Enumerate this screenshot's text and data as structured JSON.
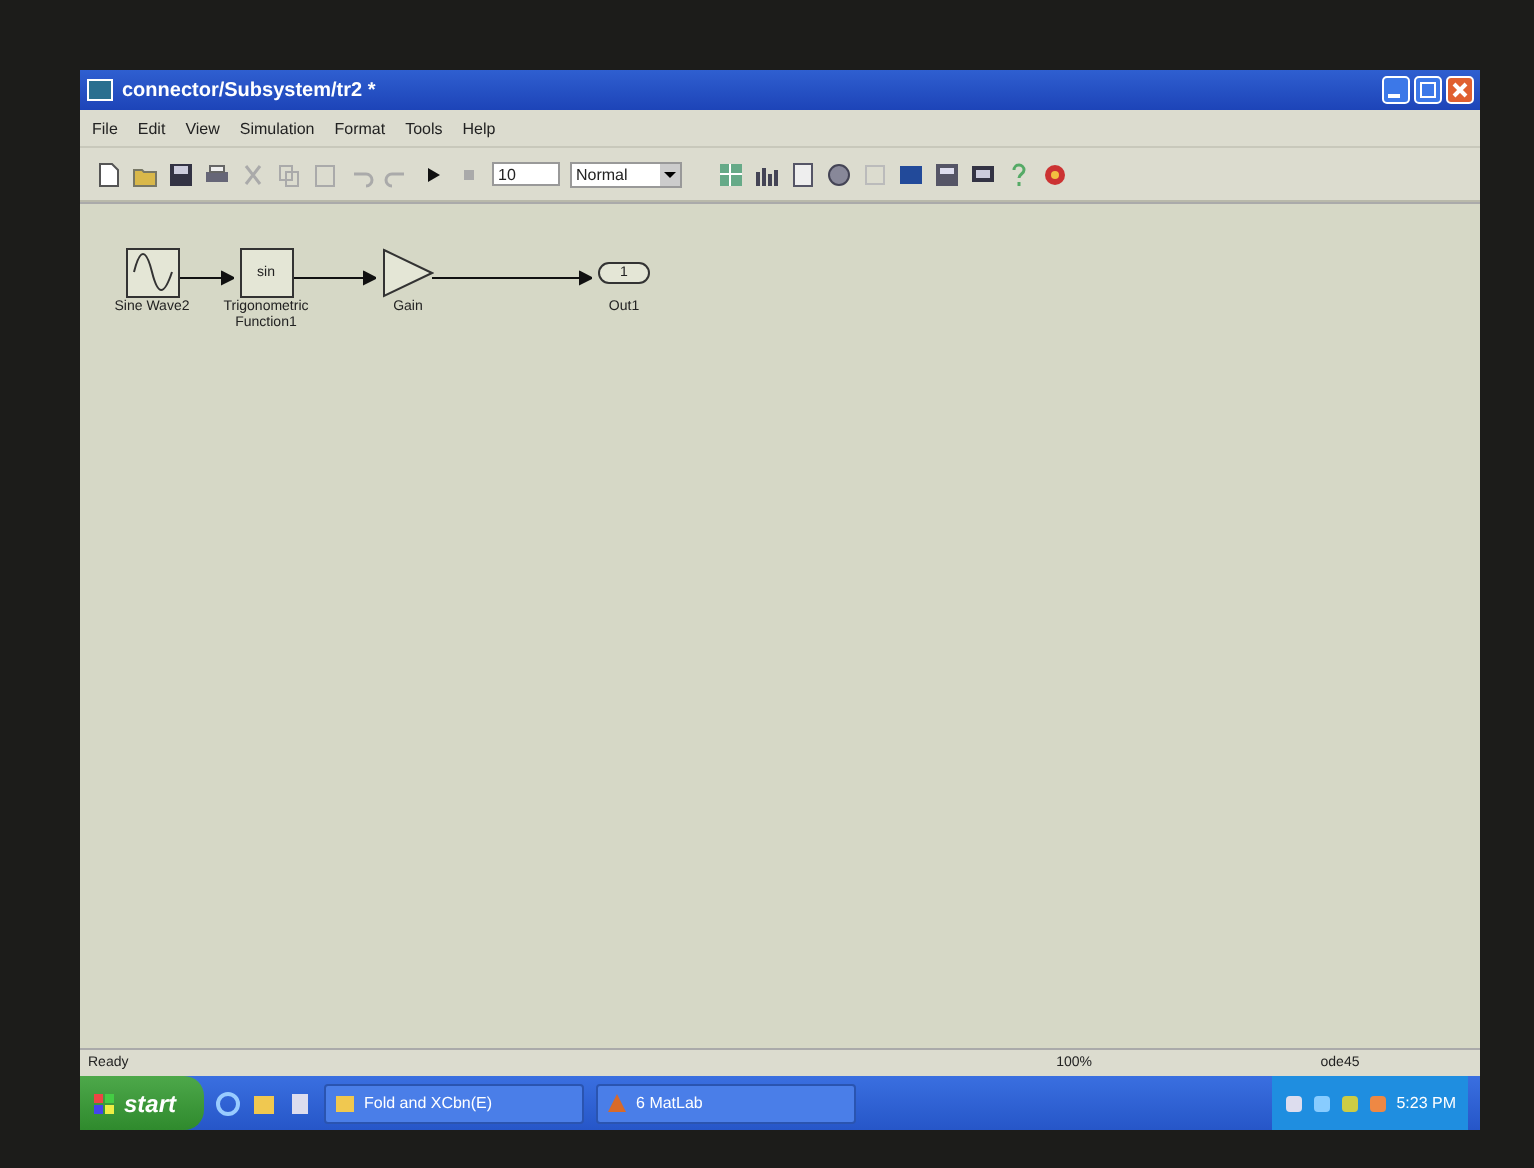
{
  "window": {
    "title": "connector/Subsystem/tr2 *"
  },
  "menu": [
    "File",
    "Edit",
    "View",
    "Simulation",
    "Format",
    "Tools",
    "Help"
  ],
  "toolbar": {
    "stop_time": "10",
    "mode": "Normal"
  },
  "diagram": {
    "blocks": [
      {
        "kind": "sine",
        "label": "Sine Wave2"
      },
      {
        "kind": "function",
        "text": "sin",
        "label": "Trigonometric Function1"
      },
      {
        "kind": "gain",
        "label": "Gain"
      },
      {
        "kind": "outport",
        "text": "1",
        "label": "Out1"
      }
    ]
  },
  "status_bar": {
    "state": "Ready",
    "zoom": "100%",
    "solver": "ode45"
  },
  "taskbar": {
    "start": "start",
    "tasks": [
      "Fold and XCbn(E)",
      "6 MatLab"
    ],
    "clock": "5:23 PM"
  }
}
